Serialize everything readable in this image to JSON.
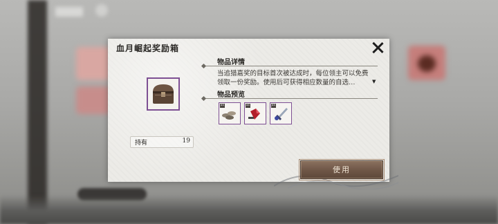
{
  "dialog": {
    "title": "血月崛起奖励箱",
    "item_details_heading": "物品详情",
    "item_description": "当追猎嘉奖的目标首次被达成时，每位领主可以免费领取一份奖励。使用后可获得相应数量的自选…",
    "item_preview_heading": "物品预览",
    "owned_label": "持有",
    "owned_count": "19",
    "use_button": "使用",
    "preview_items": [
      {
        "tag": "x1",
        "icon": "coins-icon"
      },
      {
        "tag": "x1",
        "icon": "red-gem-icon"
      },
      {
        "tag": "x1",
        "icon": "sword-icon"
      }
    ]
  },
  "colors": {
    "frame_purple": "#7d4f93",
    "button_brown": "#6e5646",
    "panel_bg": "#ecebe7"
  }
}
